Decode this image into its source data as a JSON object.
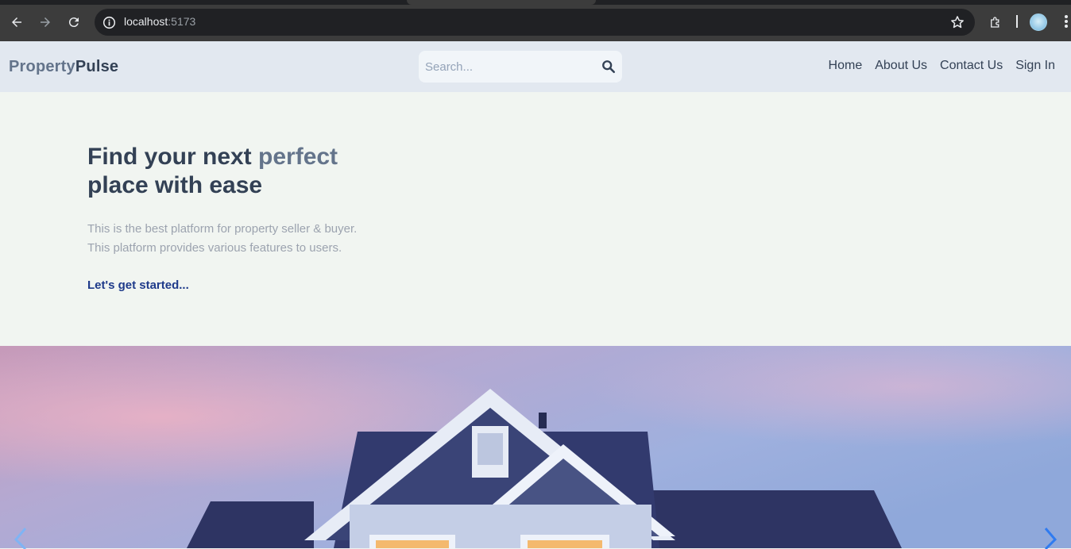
{
  "browser": {
    "url_host": "localhost",
    "url_port": ":5173"
  },
  "header": {
    "logo_part1": "Property",
    "logo_part2": "Pulse",
    "search_placeholder": "Search...",
    "nav": [
      "Home",
      "About Us",
      "Contact Us",
      "Sign In"
    ]
  },
  "hero": {
    "title_part1": "Find your next ",
    "title_highlight": "perfect",
    "title_part2": "place with ease",
    "desc_line1": "This is the best platform for property seller & buyer.",
    "desc_line2": "This platform provides various features to users.",
    "cta": "Let's get started..."
  },
  "colors": {
    "header_bg": "#e2e8f0",
    "hero_bg": "#f1f5f1",
    "title": "#334155",
    "highlight": "#64748b",
    "cta": "#1e3a8a"
  },
  "icons": [
    "back-icon",
    "forward-icon",
    "reload-icon",
    "info-icon",
    "star-icon",
    "extensions-icon",
    "kebab-menu-icon",
    "search-icon",
    "prev-arrow-icon",
    "next-arrow-icon"
  ]
}
